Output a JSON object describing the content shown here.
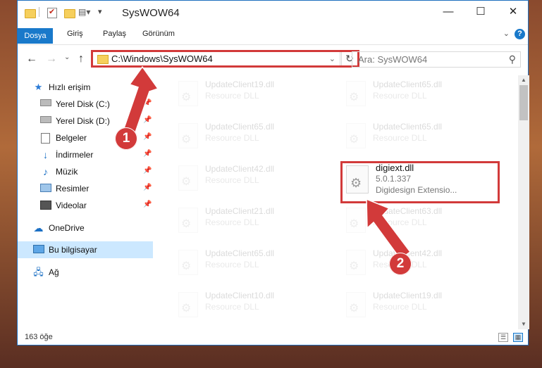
{
  "window": {
    "title": "SysWOW64",
    "controls": {
      "minimize": "—",
      "maximize": "☐",
      "close": "✕"
    }
  },
  "ribbon": {
    "file_tab": "Dosya",
    "tabs": [
      "Giriş",
      "Paylaş",
      "Görünüm"
    ],
    "help": "?"
  },
  "nav": {
    "address": "C:\\Windows\\SysWOW64",
    "search_placeholder": "Ara: SysWOW64"
  },
  "sidebar": {
    "items": [
      {
        "label": "Hızlı erişim",
        "icon": "star-icon",
        "pinned": false
      },
      {
        "label": "Yerel Disk (C:)",
        "icon": "drive-icon",
        "pinned": true
      },
      {
        "label": "Yerel Disk (D:)",
        "icon": "drive-icon",
        "pinned": true
      },
      {
        "label": "Belgeler",
        "icon": "documents-icon",
        "pinned": true
      },
      {
        "label": "İndirmeler",
        "icon": "download-icon",
        "pinned": true
      },
      {
        "label": "Müzik",
        "icon": "music-icon",
        "pinned": true
      },
      {
        "label": "Resimler",
        "icon": "pictures-icon",
        "pinned": true
      },
      {
        "label": "Videolar",
        "icon": "videos-icon",
        "pinned": true
      },
      {
        "label": "OneDrive",
        "icon": "cloud-icon",
        "pinned": false
      },
      {
        "label": "Bu bilgisayar",
        "icon": "computer-icon",
        "pinned": false,
        "selected": true
      },
      {
        "label": "Ağ",
        "icon": "network-icon",
        "pinned": false
      }
    ]
  },
  "files": {
    "left": [
      {
        "name": "UpdateClient19.dll",
        "type": "Resource DLL"
      },
      {
        "name": "UpdateClient65.dll",
        "type": "Resource DLL"
      },
      {
        "name": "UpdateClient42.dll",
        "type": "Resource DLL"
      },
      {
        "name": "UpdateClient21.dll",
        "type": "Resource DLL"
      },
      {
        "name": "UpdateClient65.dll",
        "type": "Resource DLL"
      },
      {
        "name": "UpdateClient10.dll",
        "type": "Resource DLL"
      }
    ],
    "right": [
      {
        "name": "UpdateClient65.dll",
        "type": "Resource DLL"
      },
      {
        "name": "UpdateClient65.dll",
        "type": "Resource DLL"
      },
      {
        "name": "digiext.dll",
        "version": "5.0.1.337",
        "description": "Digidesign Extensio..."
      },
      {
        "name": "UpdateClient63.dll",
        "type": "Resource DLL"
      },
      {
        "name": "UpdateClient42.dll",
        "type": "Resource DLL"
      },
      {
        "name": "UpdateClient19.dll",
        "type": "Resource DLL"
      }
    ]
  },
  "status": {
    "count": "163 öğe"
  },
  "annotations": {
    "step1": "1",
    "step2": "2",
    "color": "#d23a3a"
  }
}
